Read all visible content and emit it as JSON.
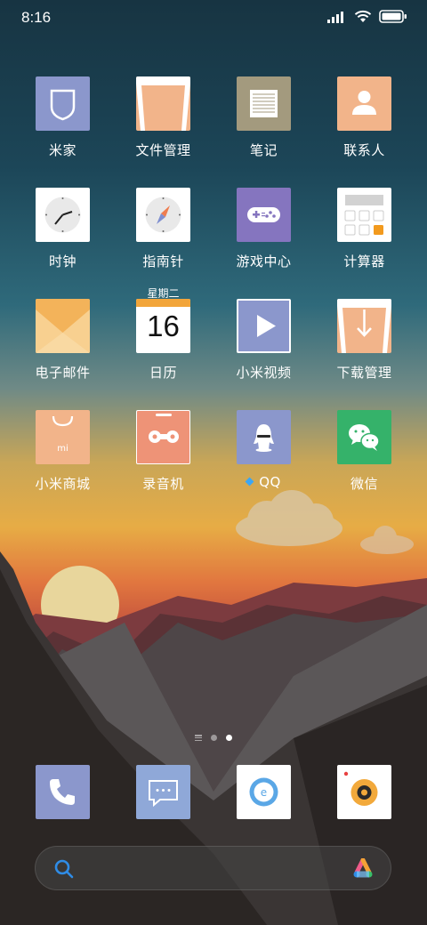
{
  "status_bar": {
    "time": "8:16",
    "icons": [
      "signal-icon",
      "wifi-icon",
      "battery-icon"
    ]
  },
  "home": {
    "apps": [
      {
        "label": "米家",
        "icon": "mijia-icon"
      },
      {
        "label": "文件管理",
        "icon": "file-manager-icon"
      },
      {
        "label": "笔记",
        "icon": "notes-icon"
      },
      {
        "label": "联系人",
        "icon": "contacts-icon"
      },
      {
        "label": "时钟",
        "icon": "clock-icon"
      },
      {
        "label": "指南针",
        "icon": "compass-icon"
      },
      {
        "label": "游戏中心",
        "icon": "gamepad-icon"
      },
      {
        "label": "计算器",
        "icon": "calculator-icon"
      },
      {
        "label": "电子邮件",
        "icon": "email-icon"
      },
      {
        "label": "日历",
        "icon": "calendar-icon"
      },
      {
        "label": "小米视频",
        "icon": "video-icon"
      },
      {
        "label": "下载管理",
        "icon": "download-icon"
      },
      {
        "label": "小米商城",
        "icon": "mi-store-icon"
      },
      {
        "label": "录音机",
        "icon": "recorder-icon"
      },
      {
        "label": "QQ",
        "icon": "qq-icon"
      },
      {
        "label": "微信",
        "icon": "wechat-icon"
      }
    ],
    "calendar": {
      "weekday": "星期二",
      "day": "16"
    },
    "mi_store_logo": "mi"
  },
  "page_indicator": {
    "pages": 2,
    "current": 2
  },
  "dock": [
    {
      "icon": "phone-icon"
    },
    {
      "icon": "messages-icon"
    },
    {
      "icon": "browser-icon"
    },
    {
      "icon": "music-icon"
    }
  ],
  "search": {
    "placeholder": ""
  },
  "colors": {
    "sky_top": "#183a48",
    "sky_horizon": "#e0a844",
    "icon_blue": "#8b97cc",
    "icon_peach": "#f2b48a",
    "wechat_green": "#35b26a",
    "search_accent": "#2f8ce6"
  }
}
